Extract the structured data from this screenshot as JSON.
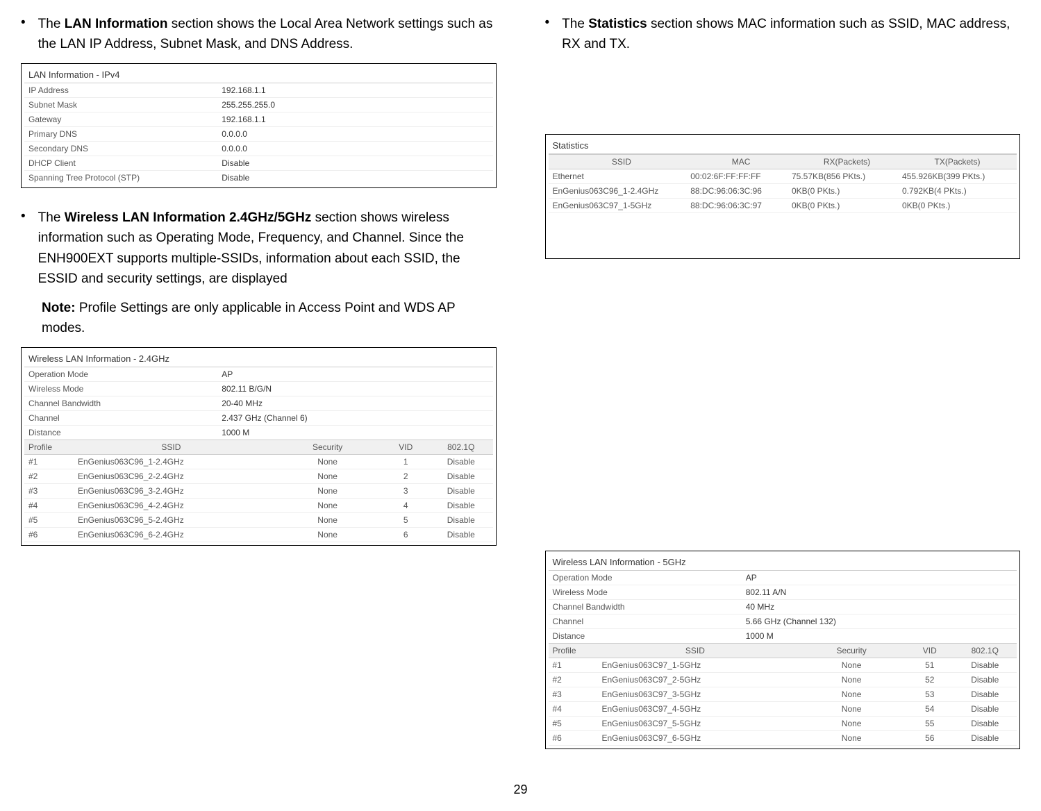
{
  "left": {
    "lan_text_prefix": "The ",
    "lan_text_bold": "LAN Information",
    "lan_text_rest": " section shows the Local Area Network settings such as the LAN IP Address, Subnet Mask, and DNS Address.",
    "wlan_text_prefix": "The ",
    "wlan_text_bold": "Wireless LAN Information 2.4GHz/5GHz",
    "wlan_text_rest": " section shows wireless information such as Operating Mode, Frequency, and Channel. Since the ENH900EXT supports multiple-SSIDs, information about each SSID, the ESSID and security settings, are displayed",
    "note_bold": "Note:",
    "note_text": " Profile Settings are only applicable in Access Point and WDS AP modes."
  },
  "right": {
    "stats_text_prefix": "The ",
    "stats_text_bold": "Statistics",
    "stats_text_rest": " section shows MAC information such as SSID, MAC address, RX and TX."
  },
  "lan_panel": {
    "title": "LAN Information - IPv4",
    "rows": [
      {
        "label": "IP Address",
        "value": "192.168.1.1"
      },
      {
        "label": "Subnet Mask",
        "value": "255.255.255.0"
      },
      {
        "label": "Gateway",
        "value": "192.168.1.1"
      },
      {
        "label": "Primary DNS",
        "value": "0.0.0.0"
      },
      {
        "label": "Secondary DNS",
        "value": "0.0.0.0"
      },
      {
        "label": "DHCP Client",
        "value": "Disable"
      },
      {
        "label": "Spanning Tree Protocol (STP)",
        "value": "Disable"
      }
    ]
  },
  "stats_panel": {
    "title": "Statistics",
    "headers": {
      "ssid": "SSID",
      "mac": "MAC",
      "rx": "RX(Packets)",
      "tx": "TX(Packets)"
    },
    "rows": [
      {
        "ssid": "Ethernet",
        "mac": "00:02:6F:FF:FF:FF",
        "rx": "75.57KB(856 PKts.)",
        "tx": "455.926KB(399 PKts.)"
      },
      {
        "ssid": "EnGenius063C96_1-2.4GHz",
        "mac": "88:DC:96:06:3C:96",
        "rx": "0KB(0 PKts.)",
        "tx": "0.792KB(4 PKts.)"
      },
      {
        "ssid": "EnGenius063C97_1-5GHz",
        "mac": "88:DC:96:06:3C:97",
        "rx": "0KB(0 PKts.)",
        "tx": "0KB(0 PKts.)"
      }
    ]
  },
  "wlan24": {
    "title": "Wireless LAN Information - 2.4GHz",
    "info": [
      {
        "label": "Operation Mode",
        "value": "AP"
      },
      {
        "label": "Wireless Mode",
        "value": "802.11 B/G/N"
      },
      {
        "label": "Channel Bandwidth",
        "value": "20-40 MHz"
      },
      {
        "label": "Channel",
        "value": "2.437 GHz (Channel 6)"
      },
      {
        "label": "Distance",
        "value": "1000 M"
      }
    ],
    "headers": {
      "profile": "Profile",
      "ssid": "SSID",
      "security": "Security",
      "vid": "VID",
      "q": "802.1Q"
    },
    "rows": [
      {
        "profile": "#1",
        "ssid": "EnGenius063C96_1-2.4GHz",
        "security": "None",
        "vid": "1",
        "q": "Disable"
      },
      {
        "profile": "#2",
        "ssid": "EnGenius063C96_2-2.4GHz",
        "security": "None",
        "vid": "2",
        "q": "Disable"
      },
      {
        "profile": "#3",
        "ssid": "EnGenius063C96_3-2.4GHz",
        "security": "None",
        "vid": "3",
        "q": "Disable"
      },
      {
        "profile": "#4",
        "ssid": "EnGenius063C96_4-2.4GHz",
        "security": "None",
        "vid": "4",
        "q": "Disable"
      },
      {
        "profile": "#5",
        "ssid": "EnGenius063C96_5-2.4GHz",
        "security": "None",
        "vid": "5",
        "q": "Disable"
      },
      {
        "profile": "#6",
        "ssid": "EnGenius063C96_6-2.4GHz",
        "security": "None",
        "vid": "6",
        "q": "Disable"
      }
    ]
  },
  "wlan5": {
    "title": "Wireless LAN Information - 5GHz",
    "info": [
      {
        "label": "Operation Mode",
        "value": "AP"
      },
      {
        "label": "Wireless Mode",
        "value": "802.11 A/N"
      },
      {
        "label": "Channel Bandwidth",
        "value": "40 MHz"
      },
      {
        "label": "Channel",
        "value": "5.66 GHz (Channel 132)"
      },
      {
        "label": "Distance",
        "value": "1000 M"
      }
    ],
    "headers": {
      "profile": "Profile",
      "ssid": "SSID",
      "security": "Security",
      "vid": "VID",
      "q": "802.1Q"
    },
    "rows": [
      {
        "profile": "#1",
        "ssid": "EnGenius063C97_1-5GHz",
        "security": "None",
        "vid": "51",
        "q": "Disable"
      },
      {
        "profile": "#2",
        "ssid": "EnGenius063C97_2-5GHz",
        "security": "None",
        "vid": "52",
        "q": "Disable"
      },
      {
        "profile": "#3",
        "ssid": "EnGenius063C97_3-5GHz",
        "security": "None",
        "vid": "53",
        "q": "Disable"
      },
      {
        "profile": "#4",
        "ssid": "EnGenius063C97_4-5GHz",
        "security": "None",
        "vid": "54",
        "q": "Disable"
      },
      {
        "profile": "#5",
        "ssid": "EnGenius063C97_5-5GHz",
        "security": "None",
        "vid": "55",
        "q": "Disable"
      },
      {
        "profile": "#6",
        "ssid": "EnGenius063C97_6-5GHz",
        "security": "None",
        "vid": "56",
        "q": "Disable"
      }
    ]
  },
  "page_number": "29"
}
